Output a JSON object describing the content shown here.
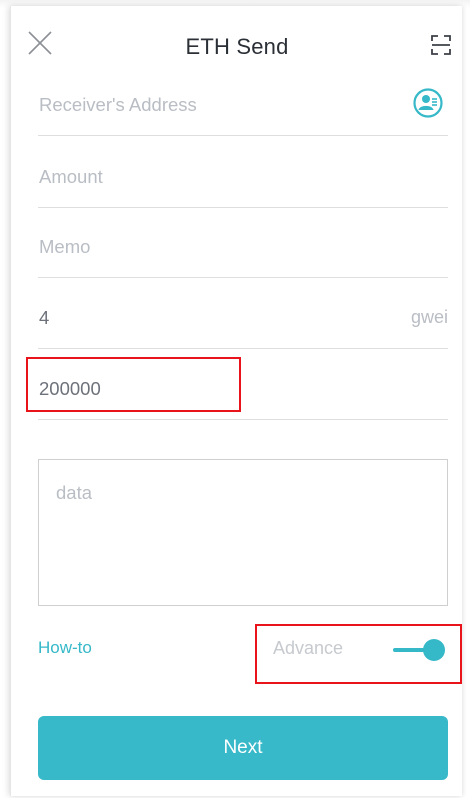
{
  "header": {
    "title": "ETH Send",
    "close_icon": "close-icon",
    "scan_icon": "scan-icon"
  },
  "form": {
    "receiver_placeholder": "Receiver's Address",
    "contacts_icon": "contacts-icon",
    "amount_placeholder": "Amount",
    "memo_placeholder": "Memo",
    "gas_price_value": "4",
    "gas_price_unit": "gwei",
    "gas_limit_value": "200000",
    "data_placeholder": "data"
  },
  "footer": {
    "howto_label": "How-to",
    "advance_label": "Advance",
    "advance_enabled": true,
    "next_label": "Next"
  },
  "colors": {
    "accent": "#37b9c9",
    "highlight": "#e8131b",
    "placeholder": "#b9bdc4",
    "title": "#2b2f36"
  }
}
